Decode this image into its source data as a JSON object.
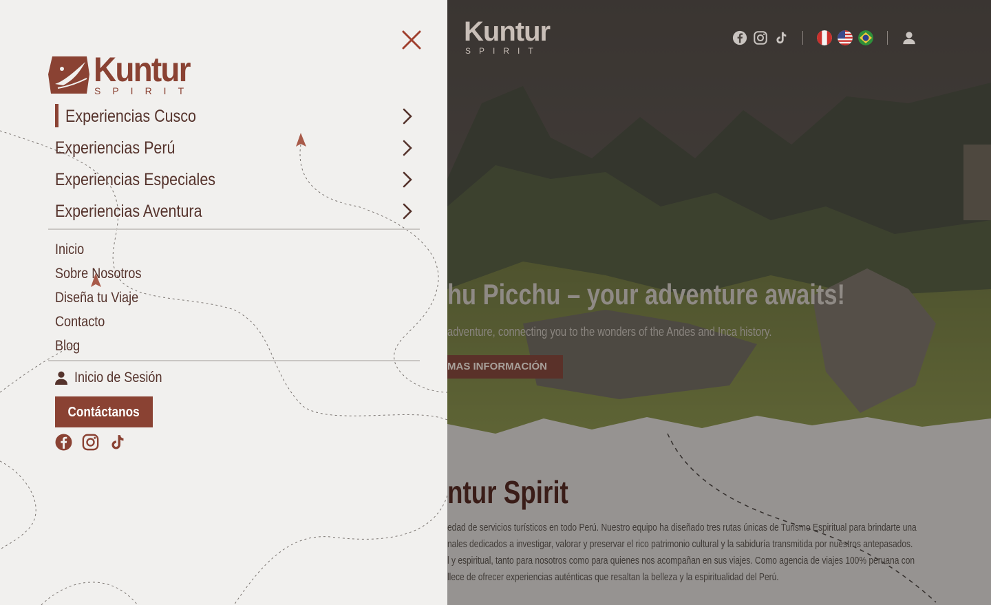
{
  "background_page": {
    "logo": {
      "word": "Kuntur",
      "sub": "SPIRIT"
    },
    "hero": {
      "title": "hu Picchu – your adventure awaits!",
      "subtitle": "adventure, connecting you to the wonders of the Andes and Inca history.",
      "button_label": "MAS INFORMACIÓN"
    },
    "section": {
      "title": "ntur Spirit",
      "lines": [
        "edad de servicios turísticos en todo Perú. Nuestro equipo ha diseñado tres rutas únicas de Turismo Espiritual para brindarte una",
        "nales dedicados a investigar, valorar y preservar el rico patrimonio cultural y la sabiduría transmitida por nuestros antepasados.",
        "l y espiritual, tanto para nosotros como para quienes nos acompañan en sus viajes. Como agencia de viajes 100% peruana con",
        "llece de ofrecer experiencias auténticas que resaltan la belleza y la espiritualidad del Perú."
      ]
    },
    "header_icons": [
      "facebook-icon",
      "instagram-icon",
      "tiktok-icon",
      "flag-peru-icon",
      "flag-usa-icon",
      "flag-brazil-icon",
      "user-icon"
    ]
  },
  "drawer": {
    "logo": {
      "word": "Kuntur",
      "sub": "SPIRIT"
    },
    "main_menu": [
      {
        "label": "Experiencias Cusco",
        "active": true
      },
      {
        "label": "Experiencias Perú",
        "active": false
      },
      {
        "label": "Experiencias Especiales",
        "active": false
      },
      {
        "label": "Experiencias Aventura",
        "active": false
      }
    ],
    "secondary_menu": [
      {
        "label": "Inicio"
      },
      {
        "label": "Sobre Nosotros"
      },
      {
        "label": "Diseña tu Viaje"
      },
      {
        "label": "Contacto"
      },
      {
        "label": "Blog"
      }
    ],
    "login_label": "Inicio de Sesión",
    "contact_button": "Contáctanos",
    "social_icons": [
      "facebook-icon",
      "instagram-icon",
      "tiktok-icon"
    ]
  },
  "colors": {
    "brand": "#8a4233",
    "menu_text": "#55332c",
    "drawer_bg": "#f1f0ee",
    "divider": "#c9c6c3"
  }
}
